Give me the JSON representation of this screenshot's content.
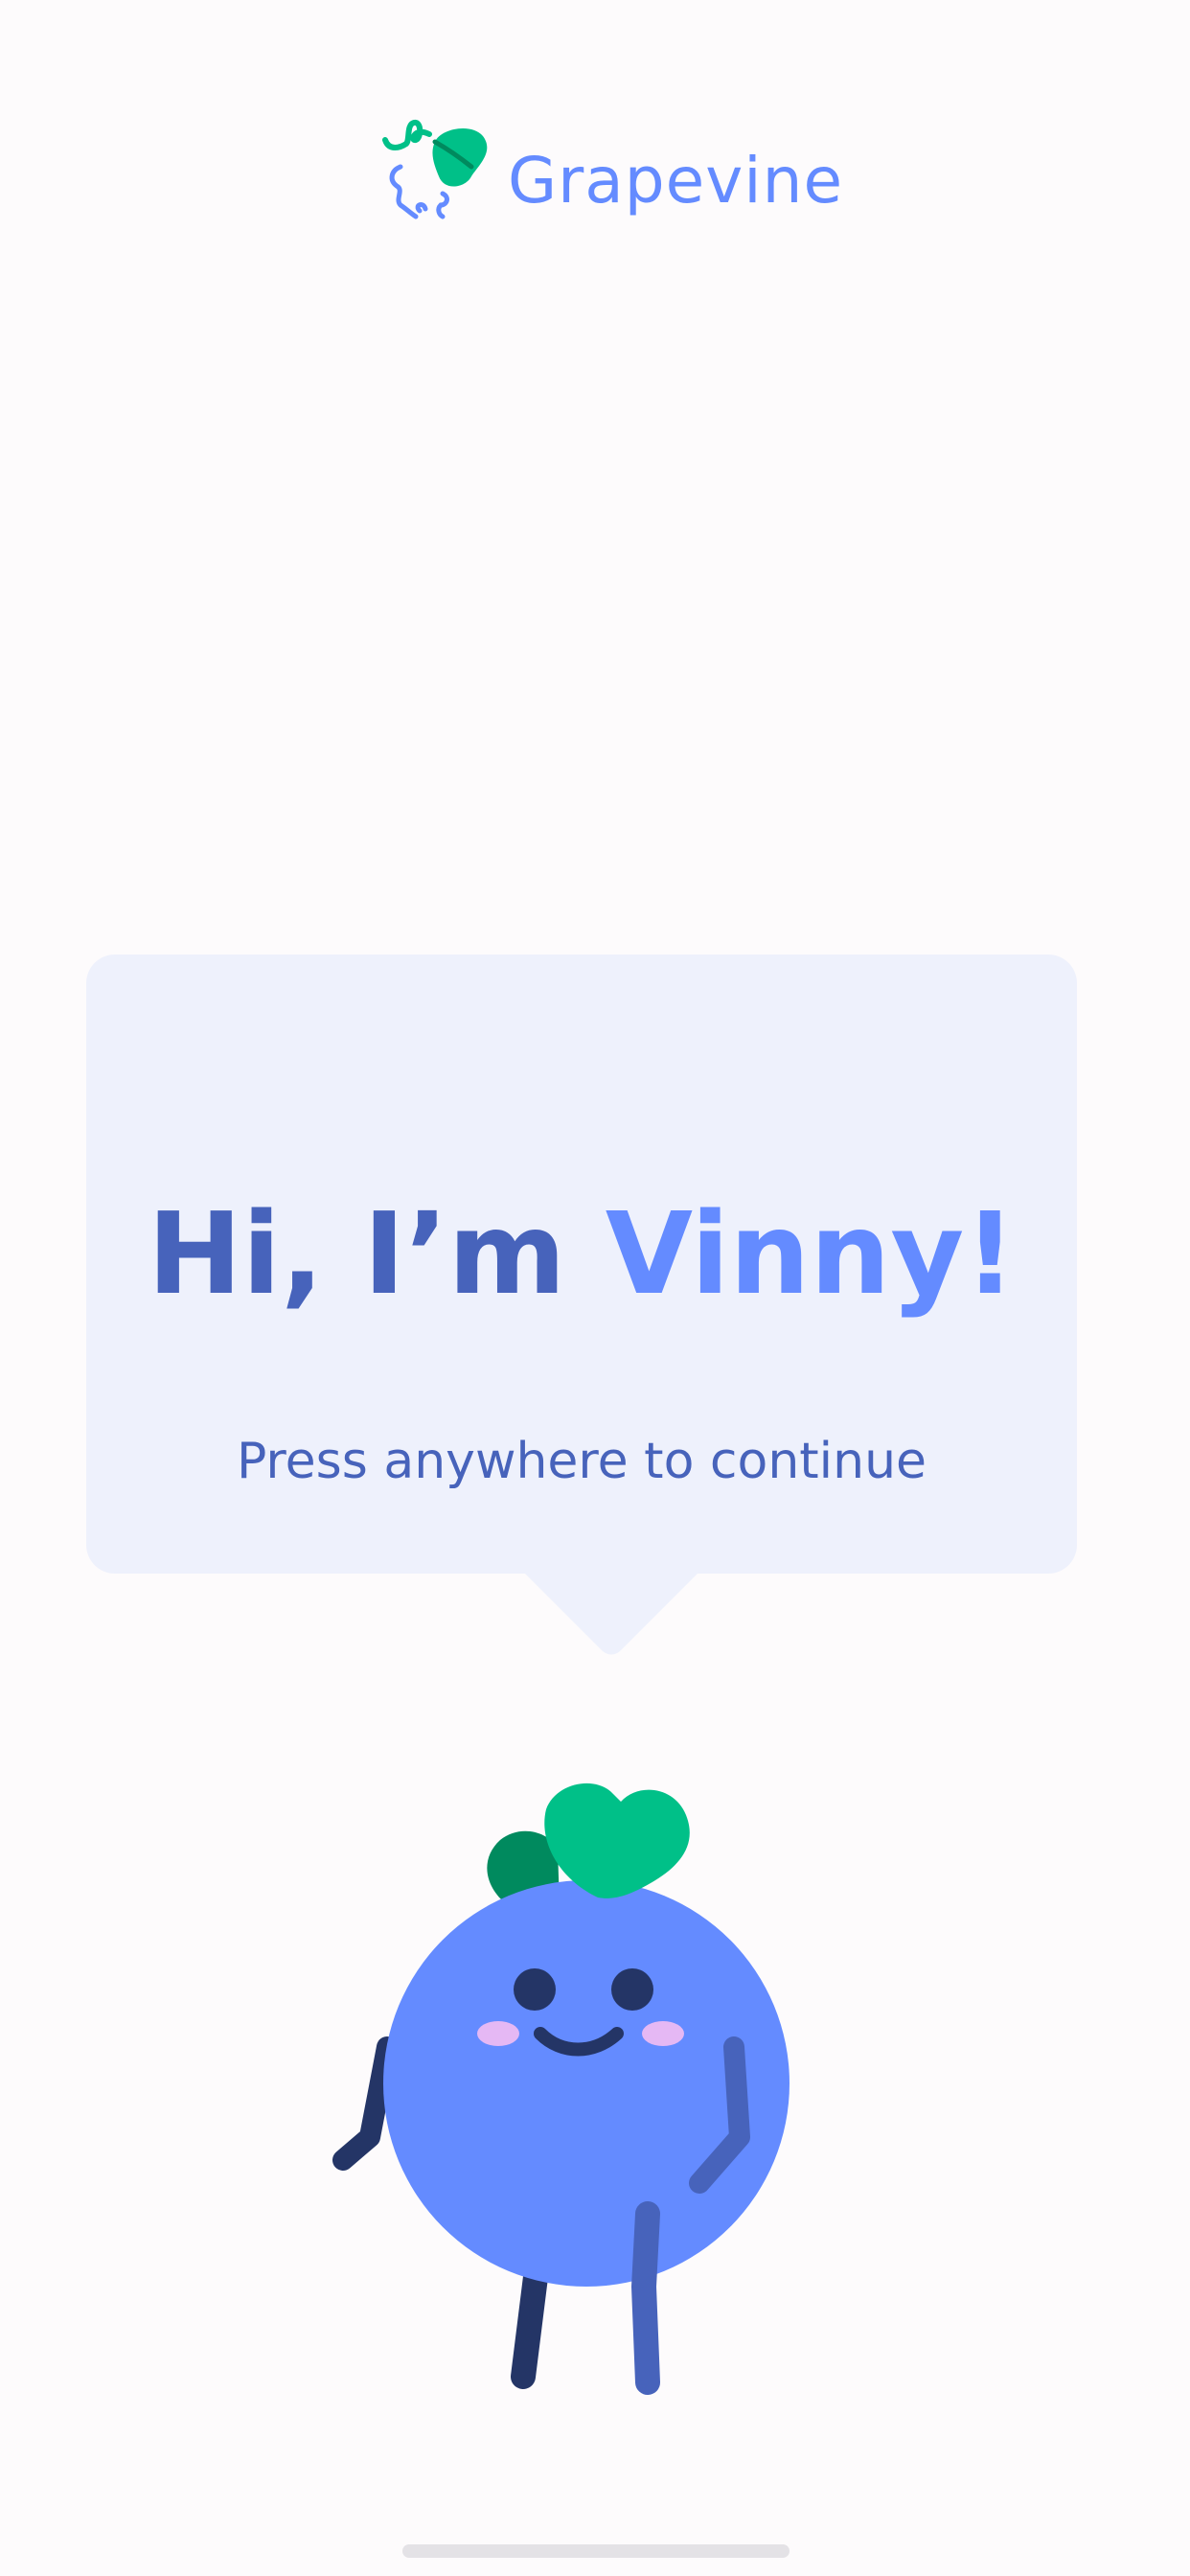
{
  "app": {
    "name": "Grapevine"
  },
  "greeting": {
    "title_prefix": "Hi, I’m ",
    "title_name": "Vinny!",
    "subtitle": "Press anywhere to continue"
  },
  "icons": {
    "logo": "grapevine-logo-icon",
    "mascot": "vinny-blueberry-mascot"
  },
  "colors": {
    "background": "#fdfbfc",
    "bubble": "#eef1fc",
    "brand_blue": "#648bff",
    "dark_blue": "#4763bb",
    "navy": "#243566",
    "leaf_green": "#00c088",
    "leaf_dark": "#008a5e",
    "blush": "#e5b8f4"
  }
}
